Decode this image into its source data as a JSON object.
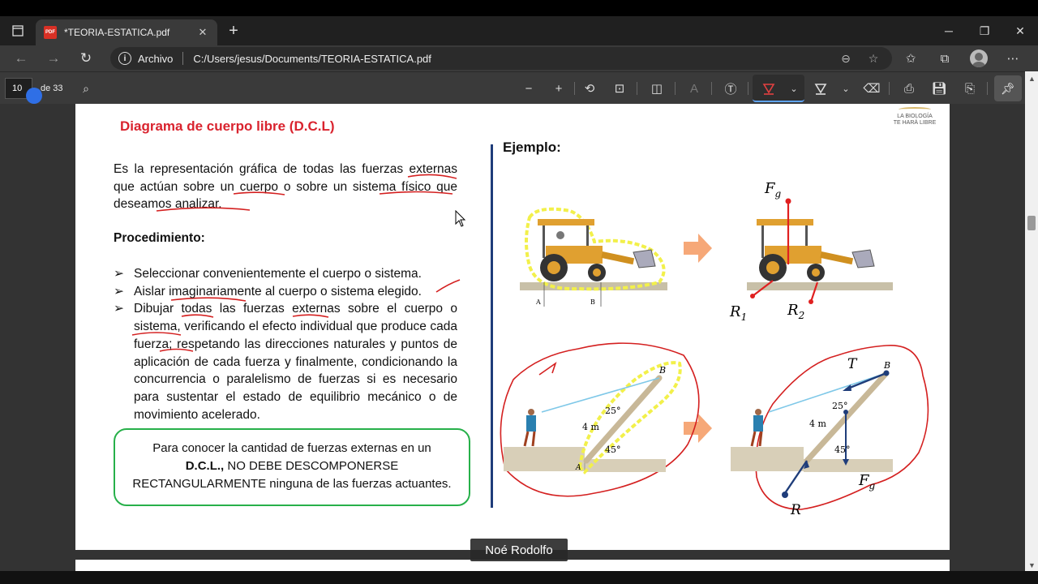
{
  "tab": {
    "title": "*TEORIA-ESTATICA.pdf",
    "badge": "PDF"
  },
  "address": {
    "site_label": "Archivo",
    "url": "C:/Users/jesus/Documents/TEORIA-ESTATICA.pdf"
  },
  "pdf_toolbar": {
    "page_current": "10",
    "page_total": "de 33"
  },
  "page": {
    "heading": "Diagrama de cuerpo libre (D.C.L)",
    "logo_text": [
      "LA BIOLOGÍA",
      "TE HARÁ LIBRE"
    ],
    "intro": "Es la representación gráfica de todas las fuerzas externas que actúan sobre un cuerpo o sobre un sistema físico que deseamos analizar.",
    "procedure_title": "Procedimiento:",
    "steps": [
      "Seleccionar convenientemente el cuerpo o sistema.",
      "Aislar imaginariamente al cuerpo o sistema elegido.",
      "Dibujar todas las fuerzas externas sobre el cuerpo o sistema, verificando el efecto individual que produce cada fuerza; respetando las direcciones naturales y puntos de aplicación de cada fuerza y finalmente, condicionando la concurrencia o paralelismo de fuerzas si es necesario para sustentar el estado de equilibrio mecánico o de movimiento acelerado."
    ],
    "note": {
      "line1": "Para conocer la cantidad de fuerzas externas en un",
      "line2_bold": "D.C.L.,",
      "line2_rest": " NO DEBE DESCOMPONERSE",
      "line3": "RECTANGULARMENTE ninguna de las fuerzas actuantes."
    },
    "example_title": "Ejemplo:",
    "figure_labels": {
      "Fg": "F",
      "Fg_sub": "g",
      "R1": "R",
      "R1_sub": "1",
      "R2": "R",
      "R2_sub": "2",
      "A": "A",
      "B": "B",
      "T": "T",
      "R": "R",
      "length": "4 m",
      "angle1": "25°",
      "angle2": "45°"
    }
  },
  "overlay": {
    "name": "Noé Rodolfo"
  },
  "colors": {
    "heading": "#d9232e",
    "note_border": "#27b04a",
    "divider": "#1f3d7a",
    "annotation": "#d42020",
    "highlight": "#f2f04a"
  }
}
